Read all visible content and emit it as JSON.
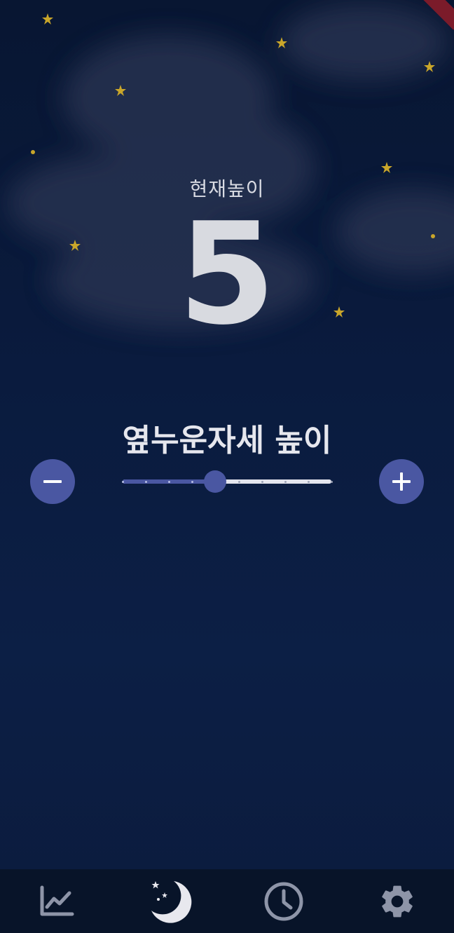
{
  "current": {
    "label": "현재높이",
    "value": "5"
  },
  "section": {
    "title": "옆누운자세 높이"
  },
  "slider": {
    "min": 1,
    "max": 10,
    "value": 5,
    "accent": "#4a57a2",
    "track": "#e4e5ee"
  },
  "controls": {
    "decrease_icon": "minus-icon",
    "increase_icon": "plus-icon"
  },
  "bottom_nav": [
    {
      "icon": "chart-line-icon",
      "active": false
    },
    {
      "icon": "moon-stars-icon",
      "active": true
    },
    {
      "icon": "clock-icon",
      "active": false
    },
    {
      "icon": "gear-icon",
      "active": false
    }
  ],
  "colors": {
    "background": "#0a1b3e",
    "accent": "#4a57a2",
    "star": "#c9a62a"
  }
}
